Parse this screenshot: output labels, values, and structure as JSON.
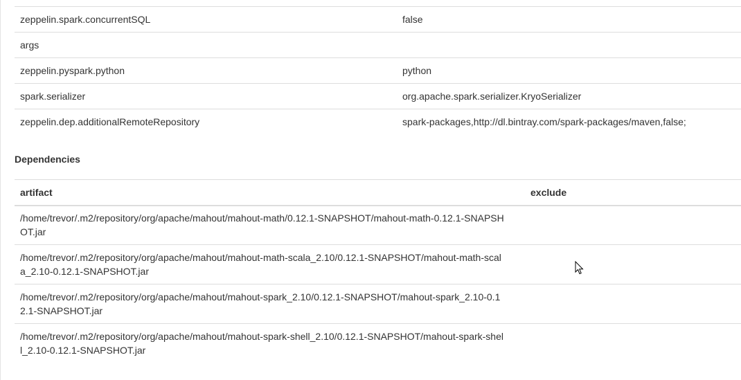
{
  "properties": [
    {
      "name": "zeppelin.spark.concurrentSQL",
      "value": "false"
    },
    {
      "name": "args",
      "value": ""
    },
    {
      "name": "zeppelin.pyspark.python",
      "value": "python"
    },
    {
      "name": "spark.serializer",
      "value": "org.apache.spark.serializer.KryoSerializer"
    },
    {
      "name": "zeppelin.dep.additionalRemoteRepository",
      "value": "spark-packages,http://dl.bintray.com/spark-packages/maven,false;"
    }
  ],
  "dependencies": {
    "title": "Dependencies",
    "columns": {
      "artifact": "artifact",
      "exclude": "exclude"
    },
    "rows": [
      {
        "artifact": "/home/trevor/.m2/repository/org/apache/mahout/mahout-math/0.12.1-SNAPSHOT/mahout-math-0.12.1-SNAPSHOT.jar",
        "exclude": ""
      },
      {
        "artifact": "/home/trevor/.m2/repository/org/apache/mahout/mahout-math-scala_2.10/0.12.1-SNAPSHOT/mahout-math-scala_2.10-0.12.1-SNAPSHOT.jar",
        "exclude": ""
      },
      {
        "artifact": "/home/trevor/.m2/repository/org/apache/mahout/mahout-spark_2.10/0.12.1-SNAPSHOT/mahout-spark_2.10-0.12.1-SNAPSHOT.jar",
        "exclude": ""
      },
      {
        "artifact": "/home/trevor/.m2/repository/org/apache/mahout/mahout-spark-shell_2.10/0.12.1-SNAPSHOT/mahout-spark-shell_2.10-0.12.1-SNAPSHOT.jar",
        "exclude": ""
      }
    ]
  },
  "cursor": {
    "icon": "mouse-pointer-icon"
  }
}
